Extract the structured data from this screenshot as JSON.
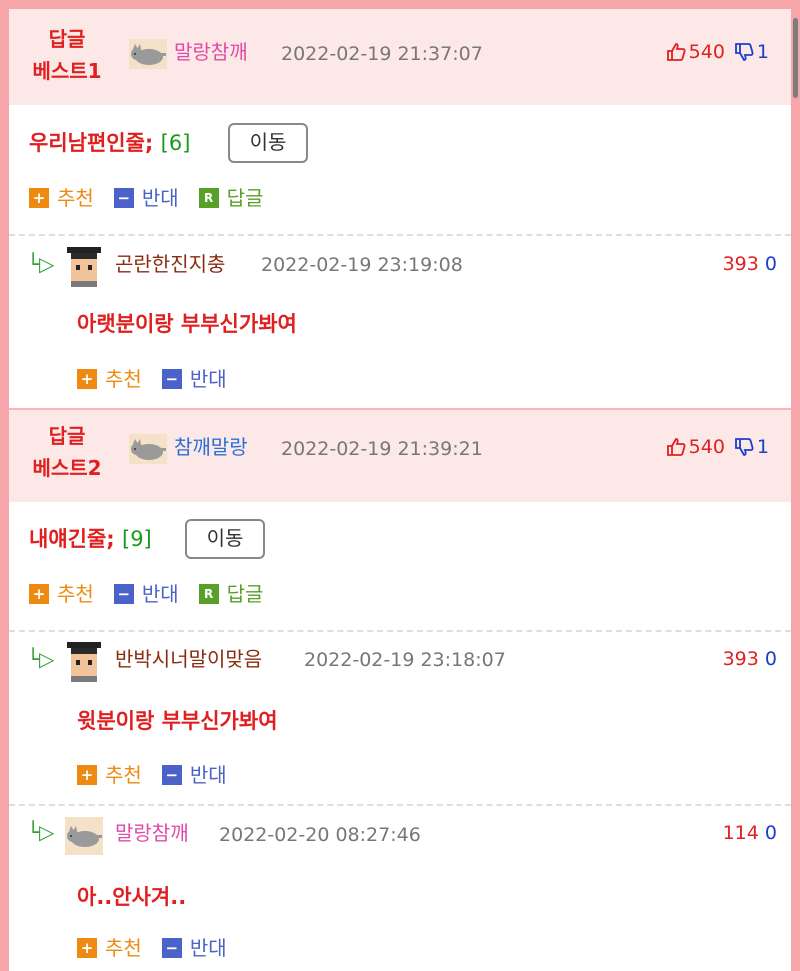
{
  "best1": {
    "label_line1": "답글",
    "label_line2": "베스트1",
    "author": "말랑참깨",
    "author_color": "#e24aa5",
    "date": "2022-02-19 21:37:07",
    "up": "540",
    "down": "1",
    "title": "우리남편인줄;",
    "count": "[6]",
    "move": "이동",
    "recommend": "추천",
    "oppose": "반대",
    "reply": "답글",
    "reply_icon": "R"
  },
  "reply1": {
    "author": "곤란한진지충",
    "date": "2022-02-19 23:19:08",
    "up": "393",
    "down": "0",
    "text": "아랫분이랑 부부신가봐여",
    "recommend": "추천",
    "oppose": "반대"
  },
  "best2": {
    "label_line1": "답글",
    "label_line2": "베스트2",
    "author": "참깨말랑",
    "author_color": "#2a6fd6",
    "date": "2022-02-19 21:39:21",
    "up": "540",
    "down": "1",
    "title": "내얘긴줄;",
    "count": "[9]",
    "move": "이동",
    "recommend": "추천",
    "oppose": "반대",
    "reply": "답글",
    "reply_icon": "R"
  },
  "reply2": {
    "author": "반박시너말이맞음",
    "date": "2022-02-19 23:18:07",
    "up": "393",
    "down": "0",
    "text": "윗분이랑 부부신가봐여",
    "recommend": "추천",
    "oppose": "반대"
  },
  "reply3": {
    "author": "말랑참깨",
    "date": "2022-02-20 08:27:46",
    "up": "114",
    "down": "0",
    "text": "아..안사겨..",
    "recommend": "추천",
    "oppose": "반대"
  },
  "icons": {
    "reply_arrow": "└▷",
    "plus": "+",
    "minus": "−"
  },
  "colors": {
    "frame": "#f7a7ab",
    "best_bg": "#fde8e8",
    "red": "#e02020",
    "blue": "#1a3ecc",
    "orange": "#ee8a12",
    "purple_blue": "#4b63c9",
    "green": "#58a02a"
  }
}
